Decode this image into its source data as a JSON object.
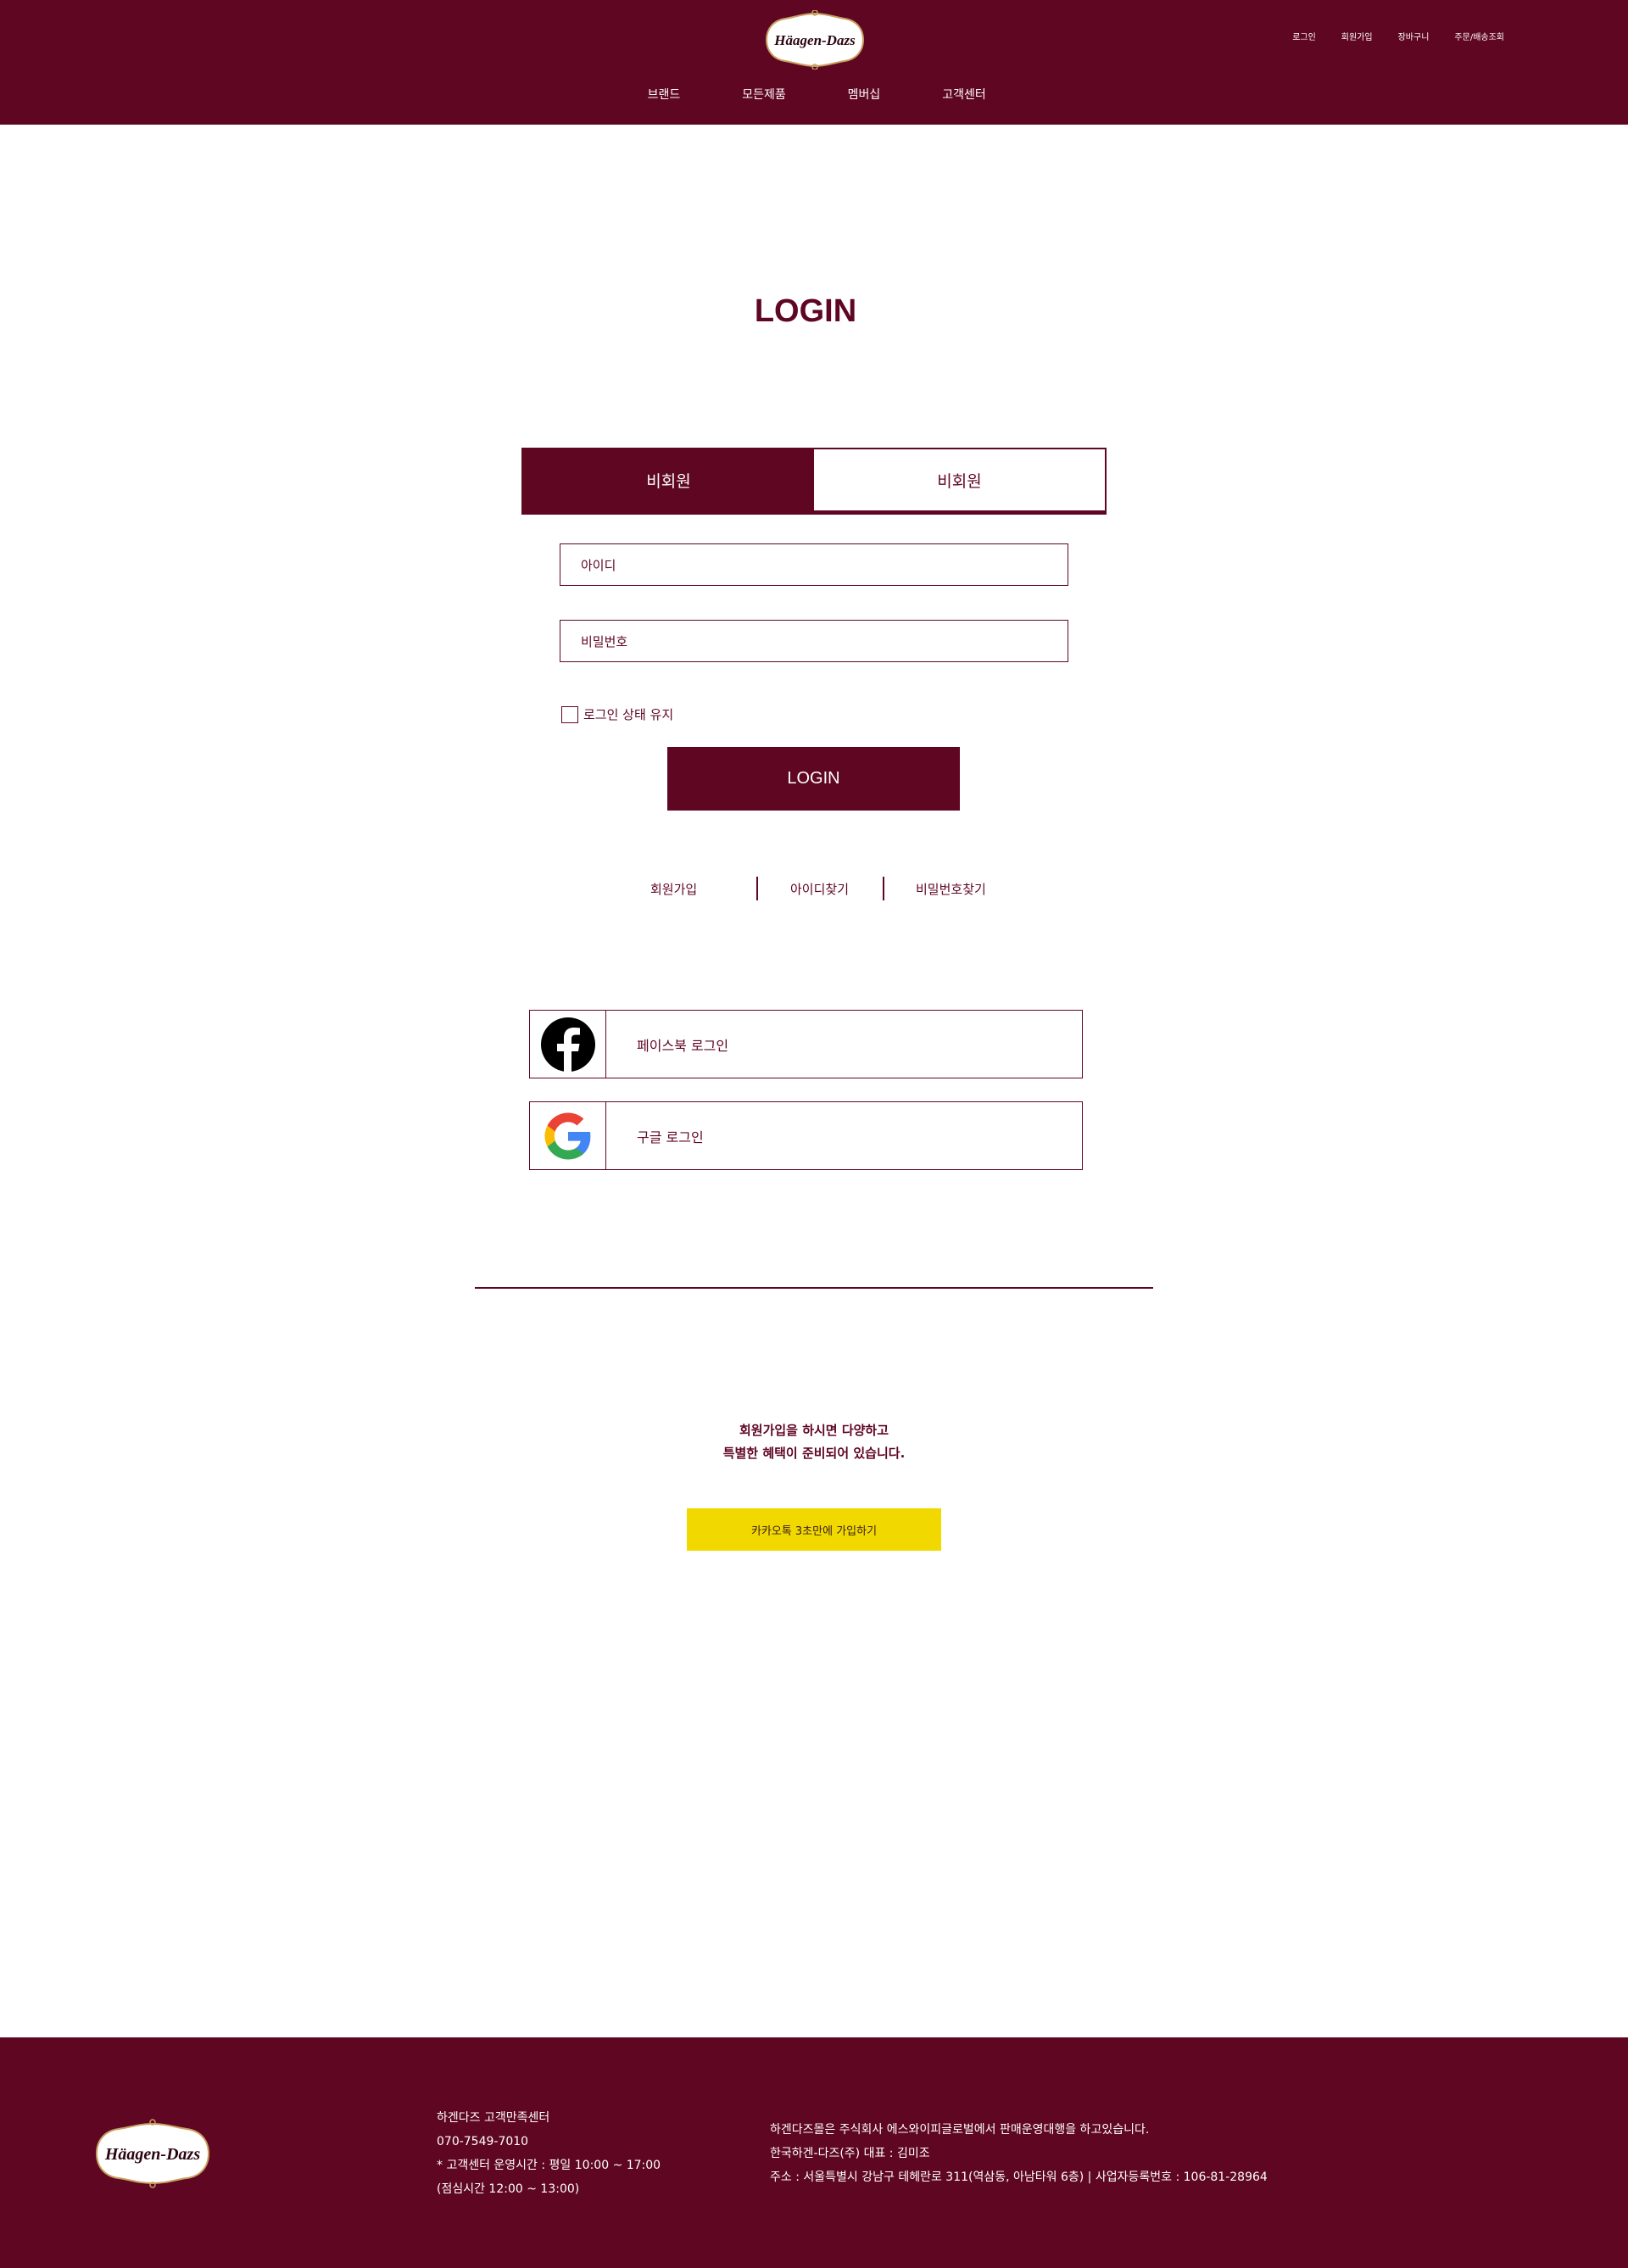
{
  "header": {
    "brand": "Häagen-Dazs",
    "util_nav": [
      "로그인",
      "회원가입",
      "장바구니",
      "주문/배송조회"
    ],
    "main_nav": [
      "브랜드",
      "모든제품",
      "멤버십",
      "고객센터"
    ]
  },
  "page_title": "LOGIN",
  "tabs": [
    {
      "label": "비회원"
    },
    {
      "label": "비회원"
    }
  ],
  "form": {
    "id_placeholder": "아이디",
    "pw_placeholder": "비밀번호",
    "keep_label": "로그인 상태 유지",
    "login_label": "LOGIN"
  },
  "links": {
    "signup": "회원가입",
    "find_id": "아이디찾기",
    "find_pw": "비밀번호찾기"
  },
  "social": {
    "facebook": "페이스북 로그인",
    "google": "구글 로그인"
  },
  "promo": {
    "line1": "회원가입을 하시면 다양하고",
    "line2": "특별한 혜택이 준비되어 있습니다."
  },
  "kakao_label": "카카오톡 3초만에 가입하기",
  "footer": {
    "brand": "Häagen-Dazs",
    "col1": [
      "하겐다즈 고객만족센터",
      "070-7549-7010",
      "* 고객센터 운영시간 : 평일 10:00 ~ 17:00",
      "(점심시간 12:00 ~ 13:00)"
    ],
    "col2": [
      "하겐다즈몰은 주식회사 에스와이피글로벌에서 판매운영대행을 하고있습니다.",
      "한국하겐-다즈(주) 대표 : 김미조",
      "주소 : 서울특별시 강남구 테헤란로 311(역삼동, 아남타워 6층) | 사업자등록번호 : 106-81-28964"
    ]
  },
  "colors": {
    "brand": "#5f0623",
    "kakao": "#f1d900",
    "white": "#ffffff"
  }
}
